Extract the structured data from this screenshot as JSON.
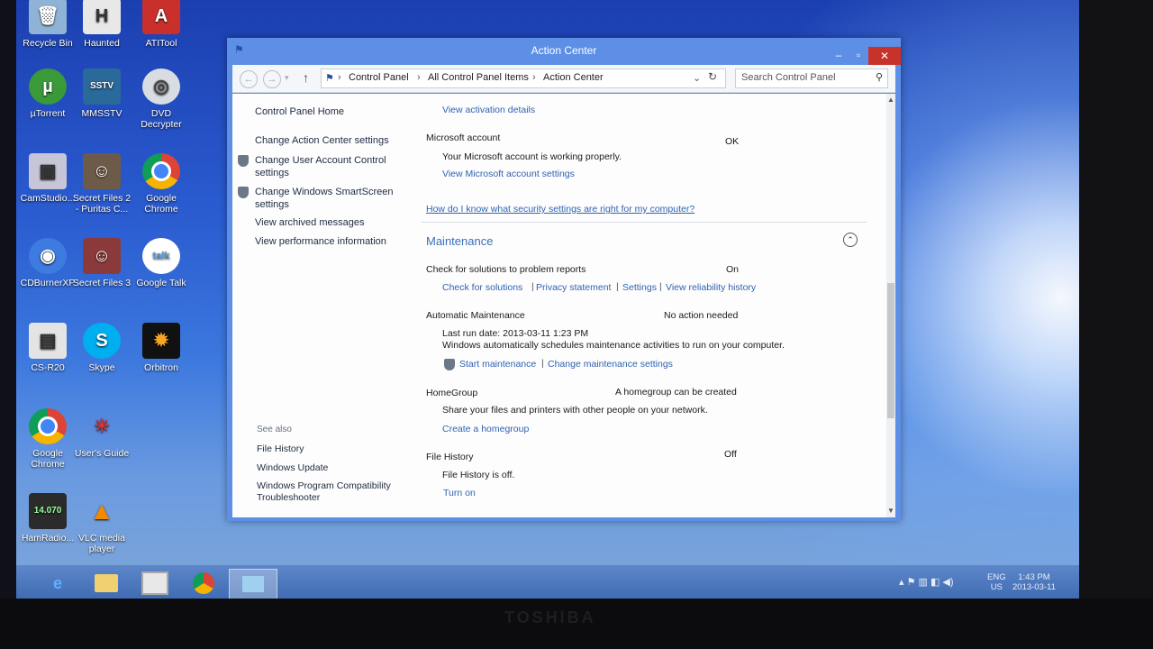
{
  "desktop": {
    "icons": [
      {
        "label": "Recycle Bin",
        "icon": "recycle-bin-icon"
      },
      {
        "label": "Haunted",
        "icon": "haunted-icon"
      },
      {
        "label": "ATITool",
        "icon": "atitool-icon"
      },
      {
        "label": "µTorrent",
        "icon": "utorrent-icon"
      },
      {
        "label": "MMSSTV",
        "icon": "mmsstv-icon"
      },
      {
        "label": "DVD Decrypter",
        "icon": "dvd-decrypter-icon"
      },
      {
        "label": "CamStudio...",
        "icon": "camstudio-icon"
      },
      {
        "label": "Secret Files 2 - Puritas C...",
        "icon": "secret-files-2-icon"
      },
      {
        "label": "Google Chrome",
        "icon": "chrome-icon"
      },
      {
        "label": "CDBurnerXP",
        "icon": "cdburnerxp-icon"
      },
      {
        "label": "Secret Files 3",
        "icon": "secret-files-3-icon"
      },
      {
        "label": "Google Talk",
        "icon": "google-talk-icon"
      },
      {
        "label": "CS-R20",
        "icon": "cs-r20-icon"
      },
      {
        "label": "Skype",
        "icon": "skype-icon"
      },
      {
        "label": "Orbitron",
        "icon": "orbitron-icon"
      },
      {
        "label": "Google Chrome",
        "icon": "chrome-icon"
      },
      {
        "label": "User's Guide",
        "icon": "users-guide-icon"
      },
      {
        "label": "HamRadio...",
        "icon": "hamradio-icon"
      },
      {
        "label": "VLC media player",
        "icon": "vlc-icon"
      }
    ]
  },
  "window": {
    "title": "Action Center",
    "breadcrumb": [
      "Control Panel",
      "All Control Panel Items",
      "Action Center"
    ],
    "search_placeholder": "Search Control Panel",
    "sidebar": {
      "home": "Control Panel Home",
      "links": [
        "Change Action Center settings",
        "Change User Account Control settings",
        "Change Windows SmartScreen settings",
        "View archived messages",
        "View performance information"
      ],
      "see_also_header": "See also",
      "see_also": [
        "File History",
        "Windows Update",
        "Windows Program Compatibility Troubleshooter"
      ]
    },
    "main": {
      "activation_link": "View activation details",
      "microsoft_account": {
        "title": "Microsoft account",
        "status": "OK",
        "desc": "Your Microsoft account is working properly.",
        "link": "View Microsoft account settings"
      },
      "security_help_link": "How do I know what security settings are right for my computer?",
      "maintenance_header": "Maintenance",
      "solutions": {
        "title": "Check for solutions to problem reports",
        "status": "On",
        "links": [
          "Check for solutions",
          "Privacy statement",
          "Settings",
          "View reliability history"
        ]
      },
      "auto_maintenance": {
        "title": "Automatic Maintenance",
        "status": "No action needed",
        "last_run": "Last run date: 2013-03-11 1:23 PM",
        "desc": "Windows automatically schedules maintenance activities to run on your computer.",
        "links": [
          "Start maintenance",
          "Change maintenance settings"
        ]
      },
      "homegroup": {
        "title": "HomeGroup",
        "status": "A homegroup can be created",
        "desc": "Share your files and printers with other people on your network.",
        "link": "Create a homegroup"
      },
      "file_history": {
        "title": "File History",
        "status": "Off",
        "desc": "File History is off.",
        "link": "Turn on"
      }
    }
  },
  "taskbar": {
    "items": [
      "internet-explorer-icon",
      "file-explorer-icon",
      "generic-app-icon",
      "chrome-icon",
      "control-panel-icon"
    ],
    "lang": "ENG",
    "region": "US",
    "time": "1:43 PM",
    "date": "2013-03-11"
  },
  "monitor_brand": "TOSHIBA",
  "colors": {
    "link": "#2f62b0",
    "maintenance_header": "#3a6fb8",
    "close_button": "#c7332a",
    "window_frame": "#5d8fe6"
  }
}
